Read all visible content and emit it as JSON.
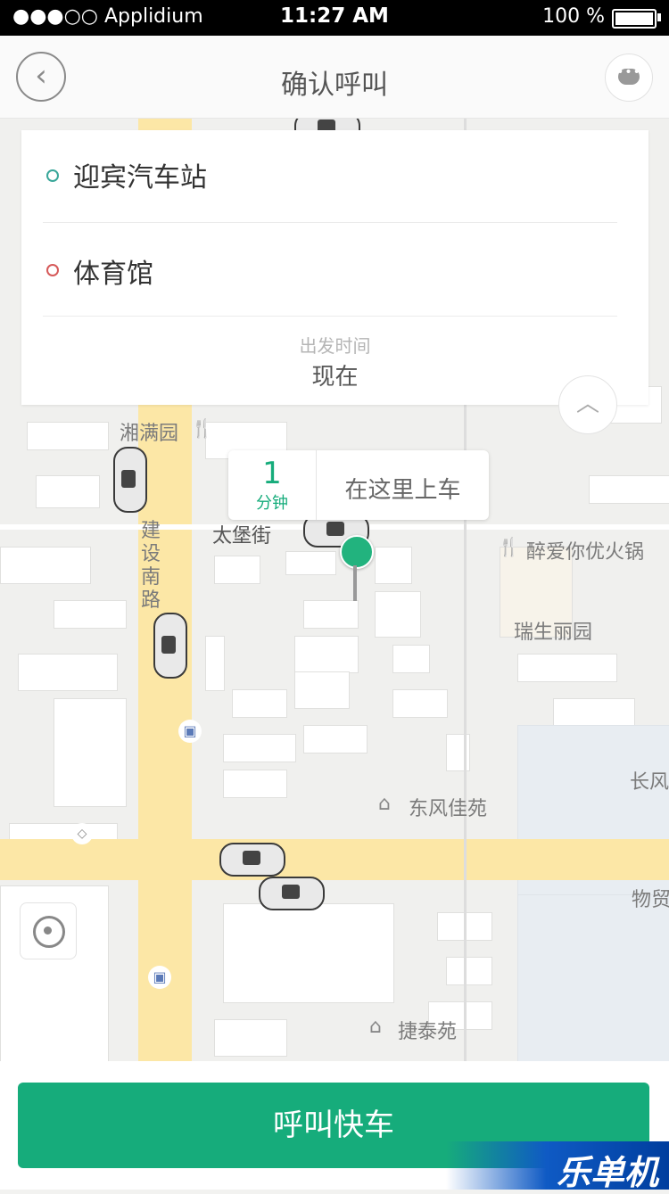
{
  "status_bar": {
    "carrier": "●●●○○ Applidium",
    "time": "11:27 AM",
    "battery": "100 %"
  },
  "nav": {
    "title": "确认呼叫",
    "back_icon": "chevron-left-icon",
    "message_icon": "chat-bubble-icon"
  },
  "route": {
    "start": "迎宾汽车站",
    "end": "体育馆",
    "departure_label": "出发时间",
    "departure_value": "现在",
    "start_color": "#3aa79a",
    "end_color": "#d65a5a"
  },
  "map": {
    "labels": [
      "湘满园",
      "太堡街",
      "醉爱你优火锅",
      "瑞生丽园",
      "东风佳苑",
      "长风",
      "物贸",
      "捷泰苑"
    ],
    "road_vertical": "建设南路"
  },
  "pickup": {
    "eta_number": "1",
    "eta_unit": "分钟",
    "action": "在这里上车"
  },
  "bottom": {
    "call_button": "呼叫快车",
    "brand": "乐单机"
  },
  "colors": {
    "accent": "#16ac7b",
    "road": "#fce7a6"
  }
}
